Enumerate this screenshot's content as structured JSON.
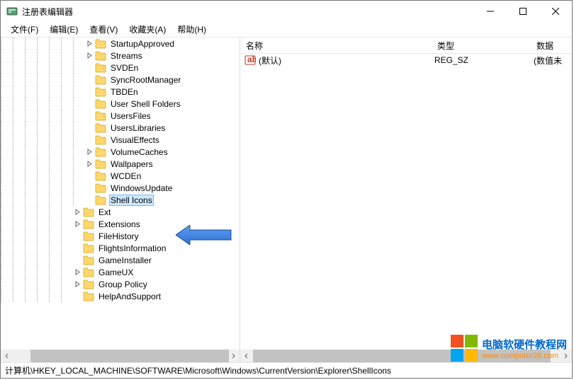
{
  "title": "注册表编辑器",
  "menus": [
    "文件(F)",
    "编辑(E)",
    "查看(V)",
    "收藏夹(A)",
    "帮助(H)"
  ],
  "tree": [
    {
      "name": "StartupApproved",
      "depth": 7,
      "exp": "plus",
      "sel": false
    },
    {
      "name": "Streams",
      "depth": 7,
      "exp": "plus",
      "sel": false
    },
    {
      "name": "SVDEn",
      "depth": 7,
      "exp": null,
      "sel": false
    },
    {
      "name": "SyncRootManager",
      "depth": 7,
      "exp": null,
      "sel": false
    },
    {
      "name": "TBDEn",
      "depth": 7,
      "exp": null,
      "sel": false
    },
    {
      "name": "User Shell Folders",
      "depth": 7,
      "exp": null,
      "sel": false
    },
    {
      "name": "UsersFiles",
      "depth": 7,
      "exp": null,
      "sel": false
    },
    {
      "name": "UsersLibraries",
      "depth": 7,
      "exp": null,
      "sel": false
    },
    {
      "name": "VisualEffects",
      "depth": 7,
      "exp": null,
      "sel": false
    },
    {
      "name": "VolumeCaches",
      "depth": 7,
      "exp": "plus",
      "sel": false
    },
    {
      "name": "Wallpapers",
      "depth": 7,
      "exp": "plus",
      "sel": false
    },
    {
      "name": "WCDEn",
      "depth": 7,
      "exp": null,
      "sel": false
    },
    {
      "name": "WindowsUpdate",
      "depth": 7,
      "exp": null,
      "sel": false
    },
    {
      "name": "Shell Icons",
      "depth": 7,
      "exp": null,
      "sel": true
    },
    {
      "name": "Ext",
      "depth": 6,
      "exp": "plus",
      "sel": false
    },
    {
      "name": "Extensions",
      "depth": 6,
      "exp": "plus",
      "sel": false
    },
    {
      "name": "FileHistory",
      "depth": 6,
      "exp": null,
      "sel": false
    },
    {
      "name": "FlightsInformation",
      "depth": 6,
      "exp": null,
      "sel": false
    },
    {
      "name": "GameInstaller",
      "depth": 6,
      "exp": null,
      "sel": false
    },
    {
      "name": "GameUX",
      "depth": 6,
      "exp": "plus",
      "sel": false
    },
    {
      "name": "Group Policy",
      "depth": 6,
      "exp": "plus",
      "sel": false
    },
    {
      "name": "HelpAndSupport",
      "depth": 6,
      "exp": null,
      "sel": false
    }
  ],
  "list": {
    "columns": {
      "name": "名称",
      "type": "类型",
      "data": "数据"
    },
    "rows": [
      {
        "name": "(默认)",
        "type": "REG_SZ",
        "data": "(数值未"
      }
    ]
  },
  "statusbar": "计算机\\HKEY_LOCAL_MACHINE\\SOFTWARE\\Microsoft\\Windows\\CurrentVersion\\Explorer\\ShellIcons",
  "watermark": {
    "line1": "电脑软硬件教程网",
    "line2": "www.computer26.com"
  }
}
